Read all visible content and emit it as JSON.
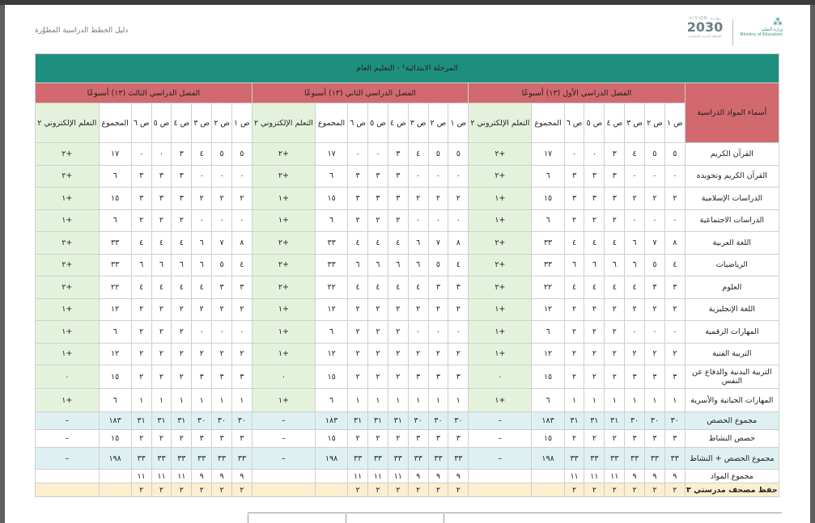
{
  "header": {
    "doc_title": "دليل الخطط الدراسية المطوَّرة",
    "vision_text": "VISION رؤيـــة",
    "vision_year": "2030",
    "vision_sub": "المملكة العربية السعودية",
    "ministry": "وزارة التعليم",
    "ministry_sub": "Ministry of Education"
  },
  "table": {
    "caption": "المرحلة الابتدائية¹ - التعليم العام",
    "subjects_header": "أسماء المواد الدراسية",
    "semesters": [
      "الفصل الدراسي الأول (١٣) أسبوعًا",
      "الفصل الدراسي الثاني (١٣) أسبوعًا",
      "الفصل الدراسي الثالث (١٣) أسبوعًا"
    ],
    "grade_headers": [
      "ص ١",
      "ص ٢",
      "ص ٣",
      "ص ٤",
      "ص ٥",
      "ص ٦"
    ],
    "total_header": "المجموع",
    "elearn_header": "التعلم الإلكتروني ٢",
    "rows": [
      {
        "name": "القرآن الكريم",
        "g": [
          "٥",
          "٥",
          "٤",
          "٣",
          "٠",
          "٠"
        ],
        "t": "١٧",
        "e": "+٢"
      },
      {
        "name": "القرآن الكريم وتجويده",
        "g": [
          "٠",
          "٠",
          "٠",
          "٣",
          "٣",
          "٣"
        ],
        "t": "٦",
        "e": "+٢"
      },
      {
        "name": "الدراسات الإسلامية",
        "g": [
          "٢",
          "٢",
          "٢",
          "٣",
          "٣",
          "٣"
        ],
        "t": "١٥",
        "e": "+١"
      },
      {
        "name": "الدراسات الاجتماعية",
        "g": [
          "٠",
          "٠",
          "٠",
          "٢",
          "٢",
          "٢"
        ],
        "t": "٦",
        "e": "+١"
      },
      {
        "name": "اللغة العربية",
        "g": [
          "٨",
          "٧",
          "٦",
          "٤",
          "٤",
          "٤"
        ],
        "t": "٣٣",
        "e": "+٢"
      },
      {
        "name": "الرياضيات",
        "g": [
          "٤",
          "٥",
          "٦",
          "٦",
          "٦",
          "٦"
        ],
        "t": "٣٣",
        "e": "+٢"
      },
      {
        "name": "العلوم",
        "g": [
          "٣",
          "٣",
          "٤",
          "٤",
          "٤",
          "٤"
        ],
        "t": "٢٢",
        "e": "+٢"
      },
      {
        "name": "اللغة الإنجليزية",
        "g": [
          "٢",
          "٢",
          "٢",
          "٢",
          "٢",
          "٢"
        ],
        "t": "١٢",
        "e": "+١"
      },
      {
        "name": "المهارات الرقمية",
        "g": [
          "٠",
          "٠",
          "٠",
          "٢",
          "٢",
          "٢"
        ],
        "t": "٦",
        "e": "+١"
      },
      {
        "name": "التربية الفنية",
        "g": [
          "٢",
          "٢",
          "٢",
          "٢",
          "٢",
          "٢"
        ],
        "t": "١٢",
        "e": "+١"
      },
      {
        "name": "التربية البدنية والدفاع عن النفس",
        "g": [
          "٣",
          "٣",
          "٣",
          "٢",
          "٢",
          "٢"
        ],
        "t": "١٥",
        "e": "٠"
      },
      {
        "name": "المهارات الحياتية والأسرية",
        "g": [
          "١",
          "١",
          "١",
          "١",
          "١",
          "١"
        ],
        "t": "٦",
        "e": "+١"
      }
    ],
    "totals": [
      {
        "name": "مجموع الحصص",
        "g": [
          "٣٠",
          "٣٠",
          "٣٠",
          "٣١",
          "٣١",
          "٣١"
        ],
        "t": "١٨٣",
        "e": "–"
      },
      {
        "name": "حصص النشاط",
        "g": [
          "٣",
          "٣",
          "٣",
          "٢",
          "٢",
          "٢"
        ],
        "t": "١٥",
        "e": "–"
      },
      {
        "name": "مجموع الحصص + النشاط",
        "g": [
          "٣٣",
          "٣٣",
          "٣٣",
          "٣٣",
          "٣٣",
          "٣٣"
        ],
        "t": "١٩٨",
        "e": "–"
      },
      {
        "name": "مجموع المواد",
        "g": [
          "٩",
          "٩",
          "٩",
          "١١",
          "١١",
          "١١"
        ],
        "t": "",
        "e": ""
      },
      {
        "name": "حفظ مصحف مدرستي ٣",
        "g": [
          "٢",
          "٢",
          "٢",
          "٢",
          "٢",
          "٢"
        ],
        "t": "",
        "e": ""
      }
    ]
  }
}
